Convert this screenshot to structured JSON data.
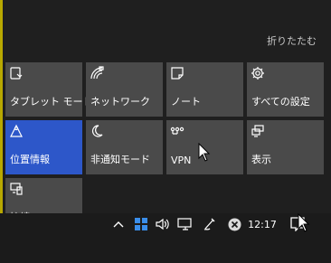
{
  "action_center": {
    "collapse_label": "折りたたむ",
    "tiles": [
      {
        "label": "タブレット モード",
        "icon": "tablet-mode-icon",
        "active": false
      },
      {
        "label": "ネットワーク",
        "icon": "network-icon",
        "active": false
      },
      {
        "label": "ノート",
        "icon": "note-icon",
        "active": false
      },
      {
        "label": "すべての設定",
        "icon": "gear-icon",
        "active": false
      },
      {
        "label": "位置情報",
        "icon": "location-icon",
        "active": true
      },
      {
        "label": "非通知モード",
        "icon": "moon-icon",
        "active": false
      },
      {
        "label": "VPN",
        "icon": "vpn-icon",
        "active": false
      },
      {
        "label": "表示",
        "icon": "display-icon",
        "active": false
      },
      {
        "label": "接続",
        "icon": "connect-icon",
        "active": false
      }
    ]
  },
  "taskbar": {
    "clock": "12:17",
    "tray_icons": [
      "chevron-up-icon",
      "windows-grid-icon",
      "volume-icon",
      "network-icon",
      "pen-icon",
      "close-circle-icon",
      "action-center-icon"
    ]
  },
  "colors": {
    "tile_bg": "#4a4a4a",
    "tile_active_bg": "#2d57c9",
    "accent_strip": "#b8a800"
  }
}
